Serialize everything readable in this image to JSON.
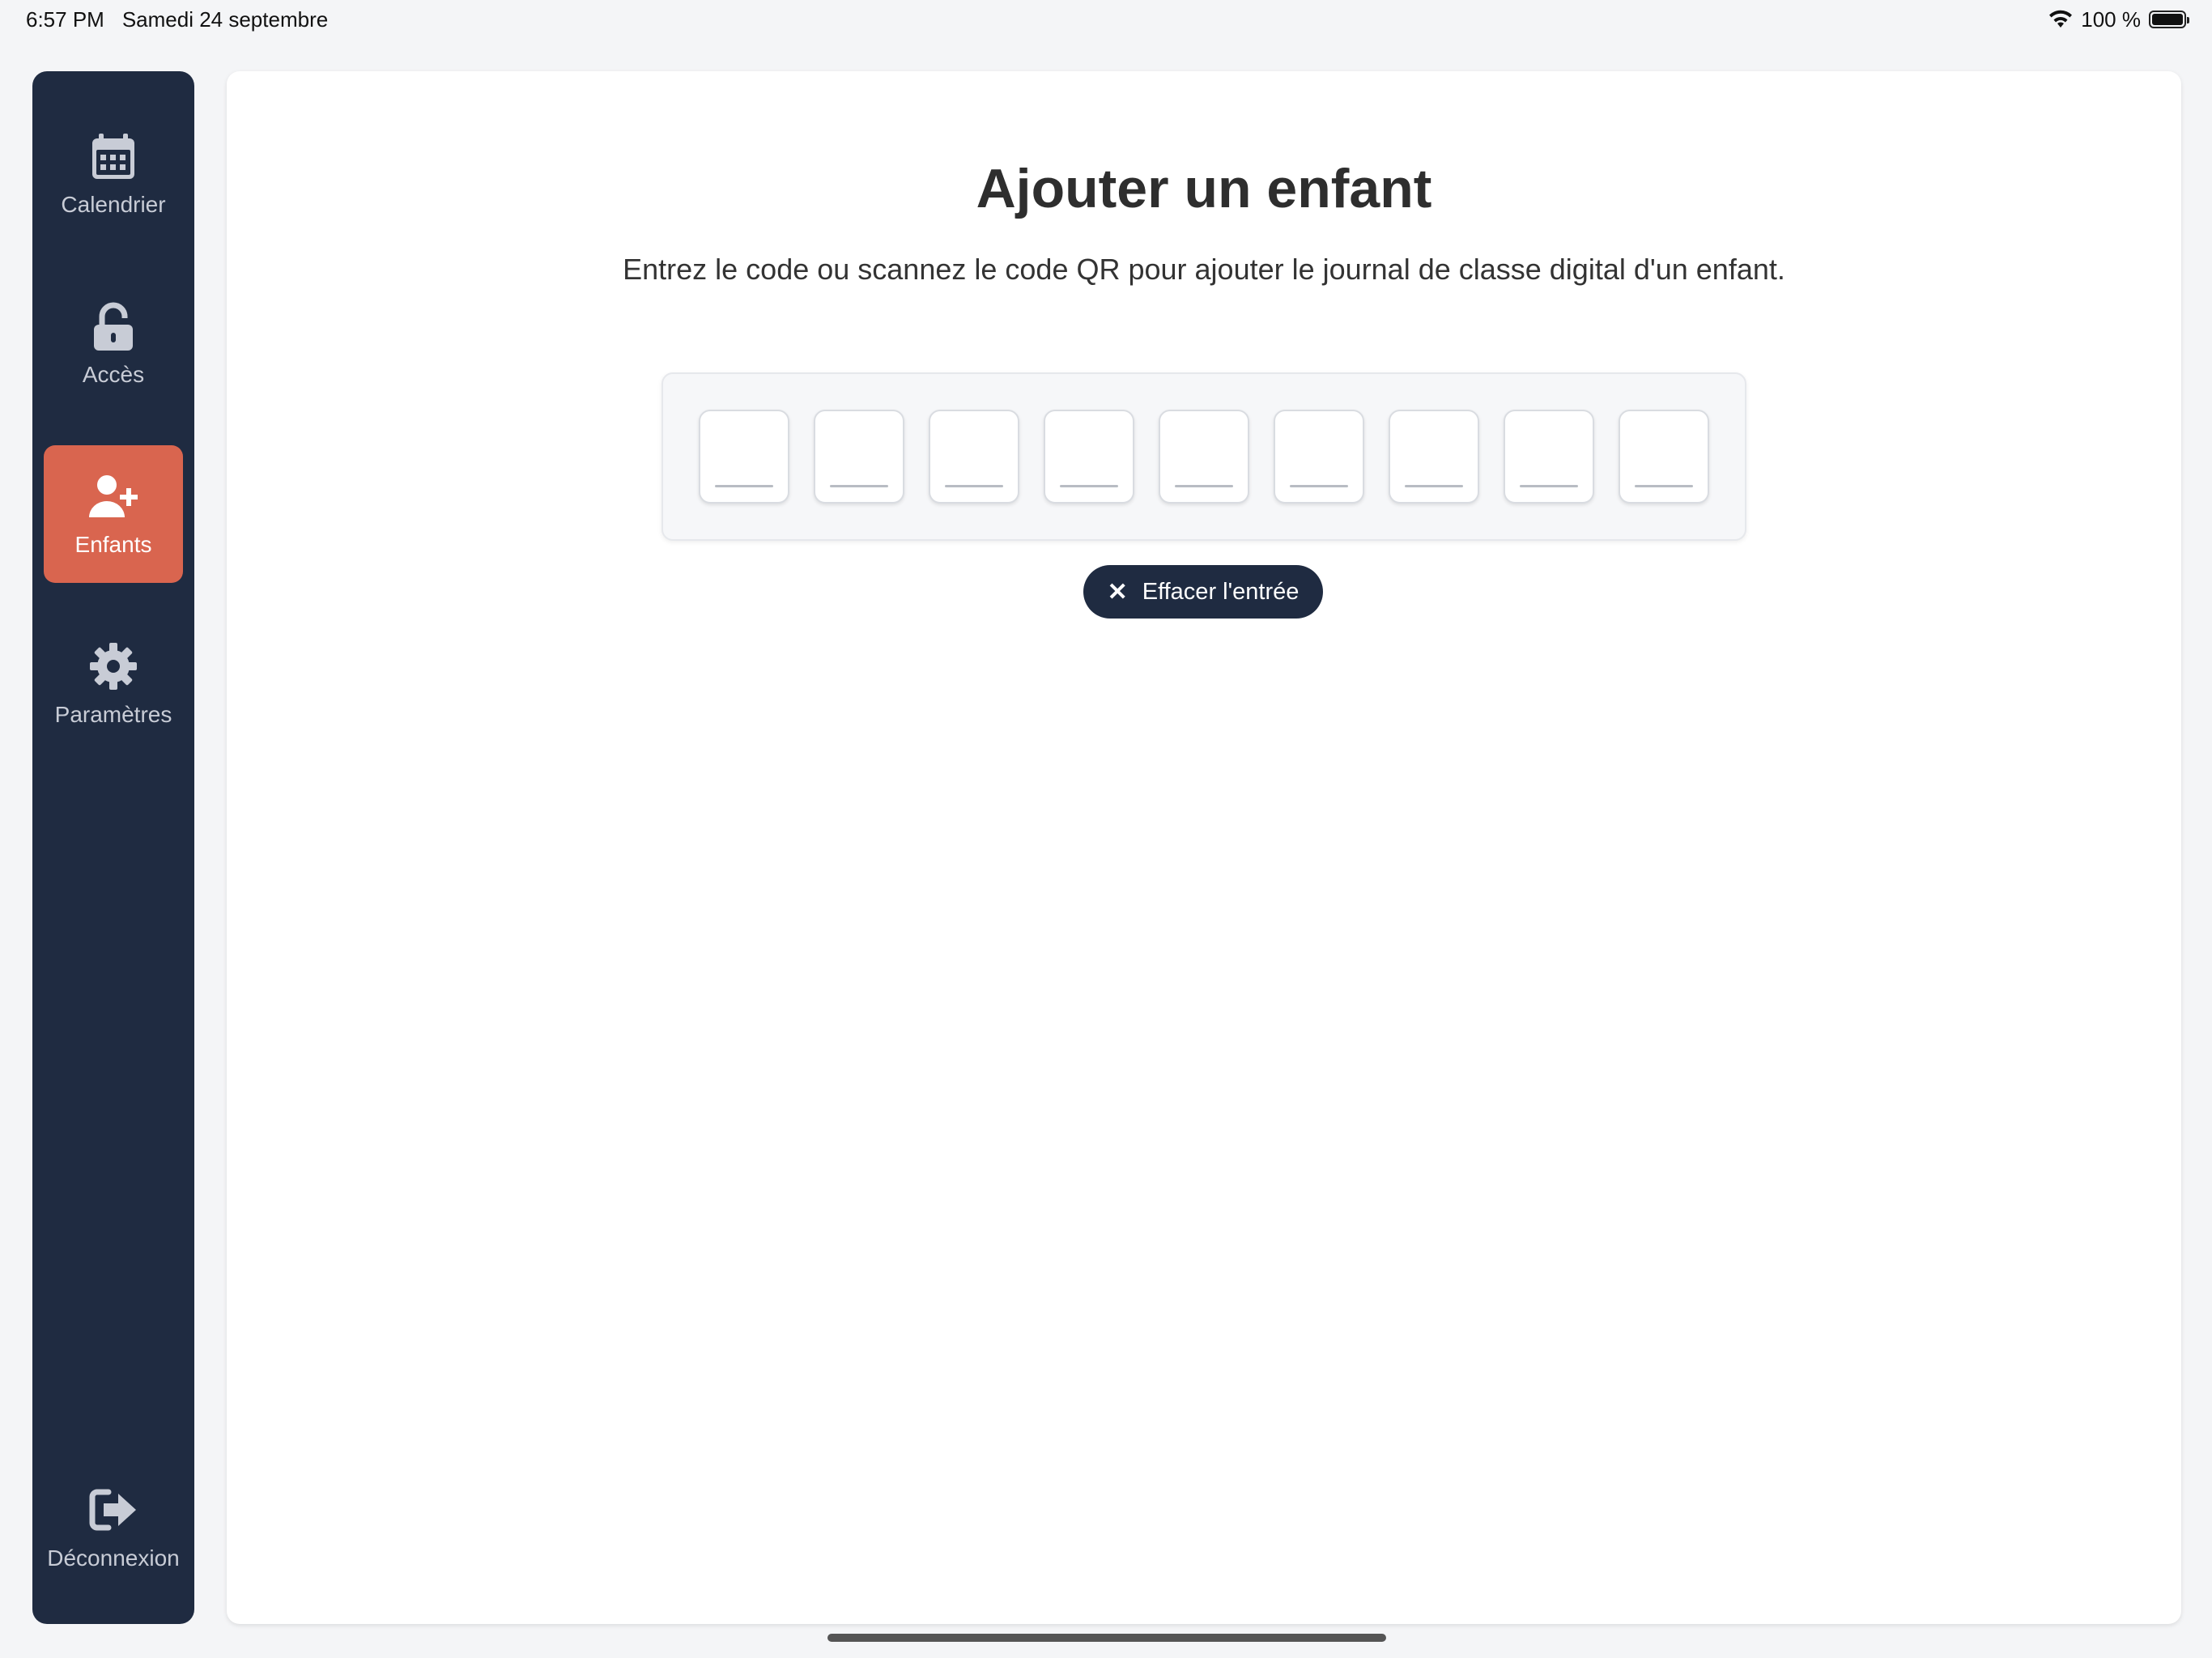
{
  "status_bar": {
    "time": "6:57 PM",
    "date": "Samedi 24 septembre",
    "battery": "100 %",
    "battery_level": 1.0
  },
  "sidebar": {
    "items": [
      {
        "label": "Calendrier",
        "icon": "calendar-icon",
        "active": false
      },
      {
        "label": "Accès",
        "icon": "unlock-icon",
        "active": false
      },
      {
        "label": "Enfants",
        "icon": "user-plus-icon",
        "active": true
      },
      {
        "label": "Paramètres",
        "icon": "gear-icon",
        "active": false
      }
    ],
    "logout": {
      "label": "Déconnexion",
      "icon": "sign-out-icon"
    }
  },
  "main": {
    "title": "Ajouter un enfant",
    "subtitle": "Entrez le code ou scannez le code QR pour ajouter le journal de classe digital d'un enfant.",
    "code_digits": [
      "",
      "",
      "",
      "",
      "",
      "",
      "",
      "",
      ""
    ],
    "clear_button_label": "Effacer l'entrée"
  },
  "colors": {
    "sidebar_bg": "#1f2b41",
    "active_item_bg": "#d9654f",
    "button_bg": "#1f2b41"
  }
}
